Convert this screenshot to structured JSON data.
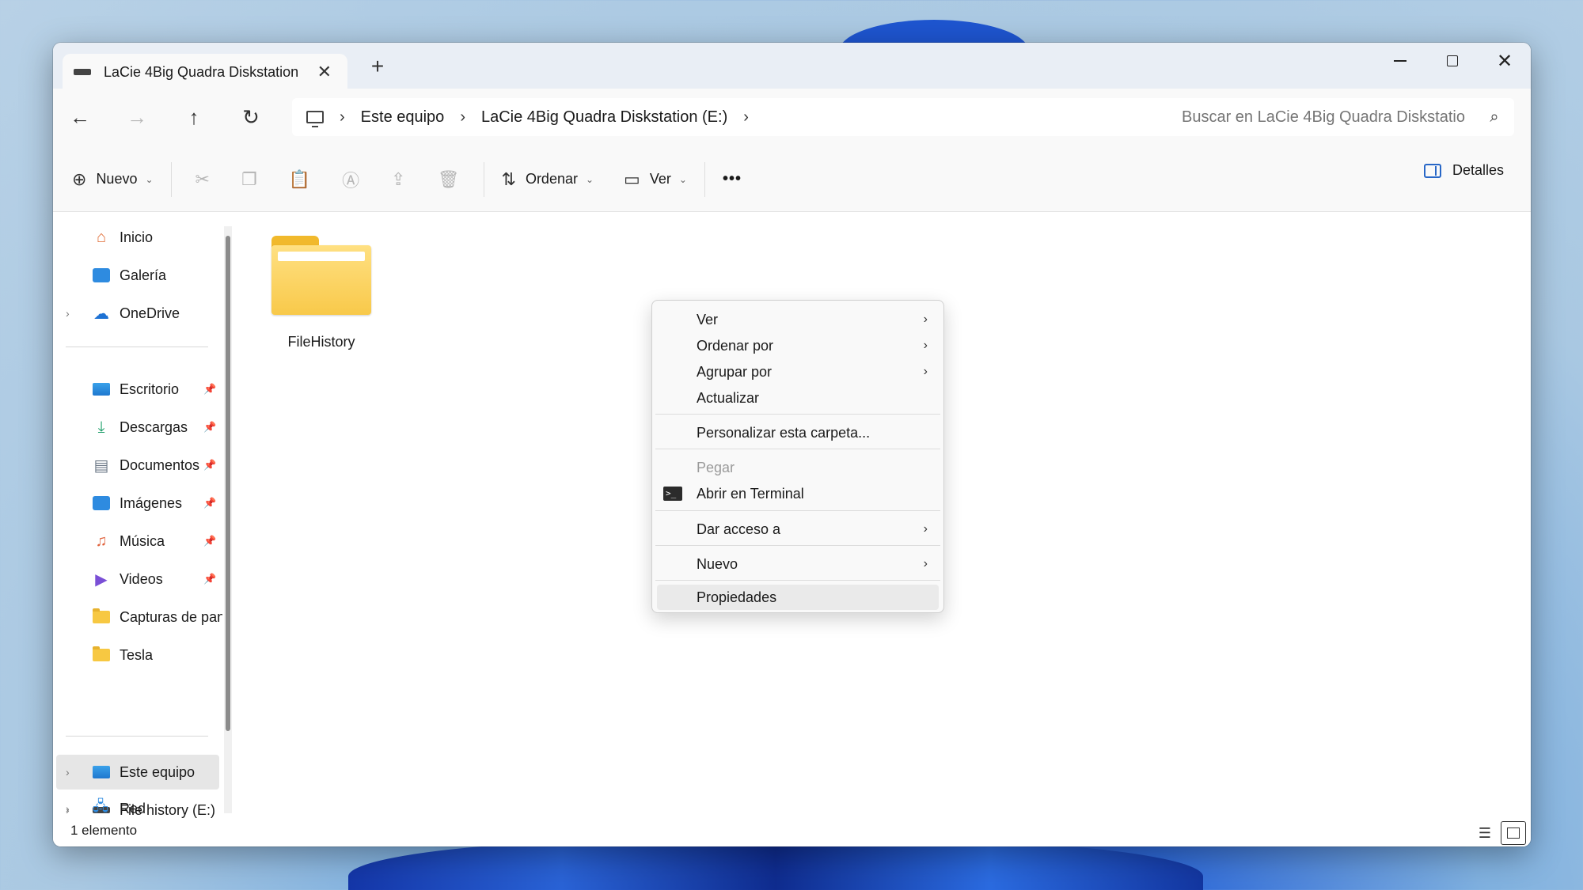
{
  "window": {
    "tab_title": "LaCie 4Big Quadra Diskstation",
    "tab_close": "✕",
    "new_tab": "+",
    "controls": {
      "min": "",
      "max": "",
      "close": "✕"
    }
  },
  "address": {
    "back": "←",
    "forward": "→",
    "up": "↑",
    "refresh": "↻",
    "breadcrumbs": [
      "Este equipo",
      "LaCie 4Big Quadra Diskstation (E:)"
    ],
    "separator": "›",
    "search_placeholder": "Buscar en LaCie 4Big Quadra Diskstatio"
  },
  "toolbar": {
    "new_label": "Nuevo",
    "sort_label": "Ordenar",
    "view_label": "Ver",
    "more": "•••",
    "details_label": "Detalles"
  },
  "sidebar": {
    "items": [
      {
        "label": "Inicio",
        "icon": "home-icon"
      },
      {
        "label": "Galería",
        "icon": "gallery-icon"
      },
      {
        "label": "OneDrive",
        "icon": "onedrive-icon"
      },
      {
        "label": "Escritorio",
        "icon": "desktop-icon"
      },
      {
        "label": "Descargas",
        "icon": "downloads-icon"
      },
      {
        "label": "Documentos",
        "icon": "documents-icon"
      },
      {
        "label": "Imágenes",
        "icon": "pictures-icon"
      },
      {
        "label": "Música",
        "icon": "music-icon"
      },
      {
        "label": "Videos",
        "icon": "videos-icon"
      },
      {
        "label": "Capturas de pantalla",
        "icon": "folder-icon"
      },
      {
        "label": "Tesla",
        "icon": "folder-icon"
      },
      {
        "label": "Este equipo",
        "icon": "this-pc-icon"
      },
      {
        "label": "File history (E:)",
        "icon": "drive-icon"
      },
      {
        "label": "Red",
        "icon": "network-icon"
      }
    ]
  },
  "content": {
    "items": [
      {
        "name": "FileHistory",
        "type": "folder"
      }
    ]
  },
  "status": {
    "count": "1 elemento"
  },
  "context_menu": {
    "items": [
      {
        "label": "Ver",
        "submenu": true
      },
      {
        "label": "Ordenar por",
        "submenu": true
      },
      {
        "label": "Agrupar por",
        "submenu": true
      },
      {
        "label": "Actualizar"
      },
      {
        "label": "Personalizar esta carpeta..."
      },
      {
        "label": "Pegar",
        "disabled": true
      },
      {
        "label": "Abrir en Terminal",
        "icon": "terminal-icon"
      },
      {
        "label": "Dar acceso a",
        "submenu": true
      },
      {
        "label": "Nuevo",
        "submenu": true
      },
      {
        "label": "Propiedades"
      }
    ],
    "arrow": "›"
  },
  "colors": {
    "accent": "#2867c7",
    "folder": "#f8c94a",
    "selected": "#e6e6e6"
  }
}
